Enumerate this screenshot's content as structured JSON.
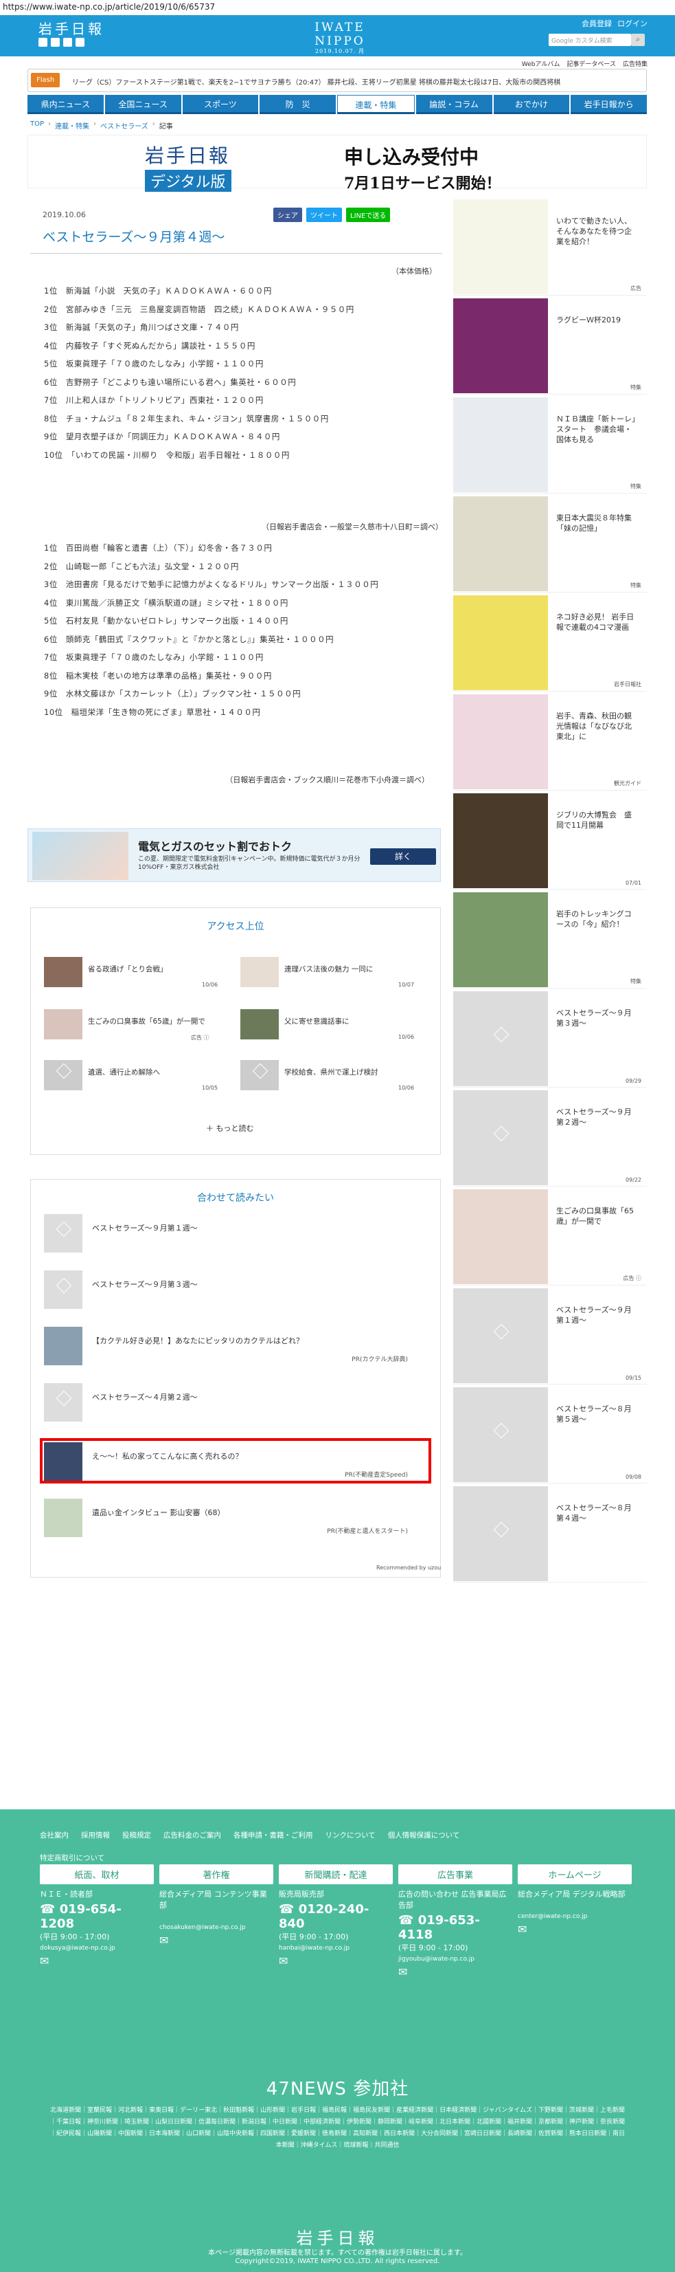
{
  "browser": {
    "url": "https://www.iwate-np.co.jp/article/2019/10/6/65737"
  },
  "header": {
    "logo": "岩手日報",
    "brand": "IWATE NIPPO",
    "brand_date": "2019.10.07. 月",
    "member": "会員登録",
    "login": "ログイン",
    "search_placeholder": "Google カスタム検索",
    "links": [
      "Webアルバム",
      "記事データベース",
      "広告特集"
    ]
  },
  "flash": {
    "tag": "Flash",
    "text": "リーグ（CS）ファーストステージ第1戦で、楽天を2−1でサヨナラ勝ち（20:47） 藤井七段、王将リーグ初黒星 将棋の藤井聡太七段は7日、大阪市の関西将棋"
  },
  "nav": [
    "県内ニュース",
    "全国ニュース",
    "スポーツ",
    "防　災",
    "連載・特集",
    "論説・コラム",
    "おでかけ",
    "岩手日報から"
  ],
  "breadcrumb": [
    "TOP",
    "連載・特集",
    "ベストセラーズ",
    "記事"
  ],
  "banner": {
    "left1": "岩手日報",
    "left2": "デジタル版",
    "right1": "申し込み受付中",
    "right2": "7月1日サービス開始！"
  },
  "article": {
    "date": "2019.10.06",
    "share": [
      "シェア",
      "ツイート",
      "LINEで送る"
    ],
    "title": "ベストセラーズ〜９月第４週〜",
    "note": "（本体価格）",
    "list1": [
      "1位　新海誠「小説　天気の子」ＫＡＤＯＫＡＷＡ・６００円",
      "2位　宮部みゆき「三元　三島屋変調百物語　四之続」ＫＡＤＯＫＡＷＡ・９５０円",
      "3位　新海誠「天気の子」角川つばさ文庫・７４０円",
      "4位　内藤牧子「すぐ死ぬんだから」講談社・１５５０円",
      "5位　坂東眞理子「７０歳のたしなみ」小学館・１１００円",
      "6位　吉野朔子「どこよりも遠い場所にいる君へ」集英社・６００円",
      "7位　川上和人ほか「トリノトリビア」西東社・１２００円",
      "8位　チョ・ナムジュ「８２年生まれ、キム・ジヨン」筑摩書房・１５００円",
      "9位　望月衣塑子ほか「同調圧力」ＫＡＤＯＫＡＷＡ・８４０円",
      "10位　「いわての民謡・川柳り　令和版」岩手日報社・１８００円"
    ],
    "src1": "（日報岩手書店会・一般堂＝久慈市十八日町＝調べ）",
    "list2": [
      "1位　百田尚樹「輪客と遺書（上）（下）」幻冬舎・各７３０円",
      "2位　山崎聡一郎「こども六法」弘文堂・１２００円",
      "3位　池田書房「見るだけで勉手に記憶力がよくなるドリル」サンマーク出版・１３００円",
      "4位　東川篤哉／浜勝正文「横浜駅道の謎」ミシマ社・１８００円",
      "5位　石村友見「動かないゼロトレ」サンマーク出版・１４００円",
      "6位　頭師克「鶴田式『スクワット』と『かかと落とし』」集英社・１０００円",
      "7位　坂東眞理子「７０歳のたしなみ」小学館・１１００円",
      "8位　稲木実枝「老いの地方は準準の品格」集英社・９００円",
      "9位　水林文藤ほか「スカーレット（上）」ブックマン社・１５００円",
      "10位　稲垣栄洋「生き物の死にざま」草思社・１４００円"
    ],
    "src2": "（日報岩手書店会・ブックス順川＝花巻市下小舟渡＝調べ）"
  },
  "ad": {
    "title": "電気とガスのセット割でおトク",
    "text": "この夏、期間限定で電気料金割引キャンペーン中。新規特価に電気代が３か月分10%OFF・東京ガス株式会社",
    "button": "詳く"
  },
  "ranking": {
    "heading": "アクセス上位",
    "items": [
      {
        "text": "省る政通げ「とり会戦」",
        "date": "10/06"
      },
      {
        "text": "連理バス法後の魅力 一同に",
        "date": "10/07"
      },
      {
        "text": "生ごみの口臭事故「65歳」が一開で",
        "date": "広告 ⓘ"
      },
      {
        "text": "父に寄せ意識話事に",
        "date": "10/06"
      },
      {
        "text": "遺選、通行止め解除へ",
        "date": "10/05"
      },
      {
        "text": "学校給食、県州で運上げ検討",
        "date": "10/06"
      }
    ],
    "more": "もっと読む"
  },
  "related": {
    "heading": "合わせて読みたい",
    "items": [
      {
        "text": "ベストセラーズ〜９月第１週〜",
        "pr": ""
      },
      {
        "text": "ベストセラーズ〜９月第３週〜",
        "pr": ""
      },
      {
        "text": "【カクテル好き必見！】あなたにピッタリのカクテルはどれ？",
        "pr": "PR(カクテル大辞典)"
      },
      {
        "text": "ベストセラーズ〜４月第２週〜",
        "pr": ""
      },
      {
        "text": "え〜〜！私の家ってこんなに高く売れるの？",
        "pr": "PR(不動産査定Speed)"
      },
      {
        "text": "遺品ぃ金インタビュー 影山安審（68）",
        "pr": "PR(不動産と遺人をスタート)"
      }
    ],
    "rec": "Recommended by uzou"
  },
  "sidebar": [
    {
      "text": "いわてで動きたい人、そんなあなたを待つ企業を紹介！",
      "badge": "広告"
    },
    {
      "text": "ラグビーＷ杯2019",
      "badge": "特集"
    },
    {
      "text": "ＮＩＢ講座「新トーレ」スタート　参議会場・国体も見る",
      "badge": "特集"
    },
    {
      "text": "東日本大震災８年特集「妹の記憶」",
      "badge": "特集"
    },
    {
      "text": "ネコ好き必見！ 岩手日報で連載の4コマ漫画",
      "badge": "岩手日報社"
    },
    {
      "text": "岩手、青森、秋田の観光情報は「なびなび北東北」に",
      "badge": "観光ガイド"
    },
    {
      "text": "ジブリの大博覧会　盛岡で11月開幕",
      "badge": "07/01"
    },
    {
      "text": "岩手のトレッキングコースの「今」紹介！",
      "badge": "特集"
    },
    {
      "text": "ベストセラーズ〜９月第３週〜",
      "badge": "09/29"
    },
    {
      "text": "ベストセラーズ〜９月第２週〜",
      "badge": "09/22"
    },
    {
      "text": "生ごみの口臭事故「65歳」が一開で",
      "badge": "広告 ⓘ"
    },
    {
      "text": "ベストセラーズ〜９月第１週〜",
      "badge": "09/15"
    },
    {
      "text": "ベストセラーズ〜８月第５週〜",
      "badge": "09/08"
    },
    {
      "text": "ベストセラーズ〜８月第４週〜",
      "badge": ""
    }
  ],
  "footer": {
    "links": [
      "会社案内",
      "採用情報",
      "投稿規定",
      "広告料金のご案内",
      "各種申請・書籍・ご利用",
      "リンクについて",
      "個人情報保護について",
      "特定商取引について"
    ],
    "cols": [
      {
        "head": "紙面、取材",
        "sub": "ＮＩＥ・読者部",
        "tel": "019-654-1208",
        "hours": "(平日 9:00 - 17:00)",
        "mail": "dokusya@iwate-np.co.jp"
      },
      {
        "head": "著作権",
        "sub": "総合メディア局 コンテンツ事業部",
        "tel": "",
        "hours": "",
        "mail": "chosakuken@iwate-np.co.jp"
      },
      {
        "head": "新聞購読・配達",
        "sub": "販売局販売部",
        "tel": "0120-240-840",
        "hours": "(平日 9:00 - 17:00)",
        "mail": "hanbai@iwate-np.co.jp"
      },
      {
        "head": "広告事業",
        "sub": "広告の問い合わせ 広告事業局広告部",
        "tel": "019-653-4118",
        "hours": "(平日 9:00 - 17:00)",
        "mail": "jigyoubu@iwate-np.co.jp"
      },
      {
        "head": "ホームページ",
        "sub": "総合メディア局 デジタル戦略部",
        "tel": "",
        "hours": "",
        "mail": "center@iwate-np.co.jp"
      }
    ],
    "n47": "47NEWS 参加社",
    "papers": "北海道新聞｜室蘭民報｜河北新報｜東奥日報｜デーリー東北｜秋田魁新報｜山形新聞｜岩手日報｜福島民報｜福島民友新聞｜産業経済新聞｜日本経済新聞｜ジャパンタイムズ｜下野新聞｜茨城新聞｜上毛新聞｜千葉日報｜神奈川新聞｜埼玉新聞｜山梨日日新聞｜信濃毎日新聞｜新潟日報｜中日新聞｜中部経済新聞｜伊勢新聞｜静岡新聞｜岐阜新聞｜北日本新聞｜北國新聞｜福井新聞｜京都新聞｜神戸新聞｜奈良新聞｜紀伊民報｜山陽新聞｜中国新聞｜日本海新聞｜山口新聞｜山陰中央新報｜四国新聞｜愛媛新聞｜徳島新聞｜高知新聞｜西日本新聞｜大分合同新聞｜宮崎日日新聞｜長崎新聞｜佐賀新聞｜熊本日日新聞｜南日本新聞｜沖縄タイムス｜琉球新報｜共同通信",
    "logo": "岩手日報",
    "copy1": "本ページ掲載内容の無断転載を禁じます。すべての著作権は岩手日報社に属します。",
    "copy2": "Copyright©2019, IWATE NIPPO CO.,LTD. All rights reserved."
  }
}
